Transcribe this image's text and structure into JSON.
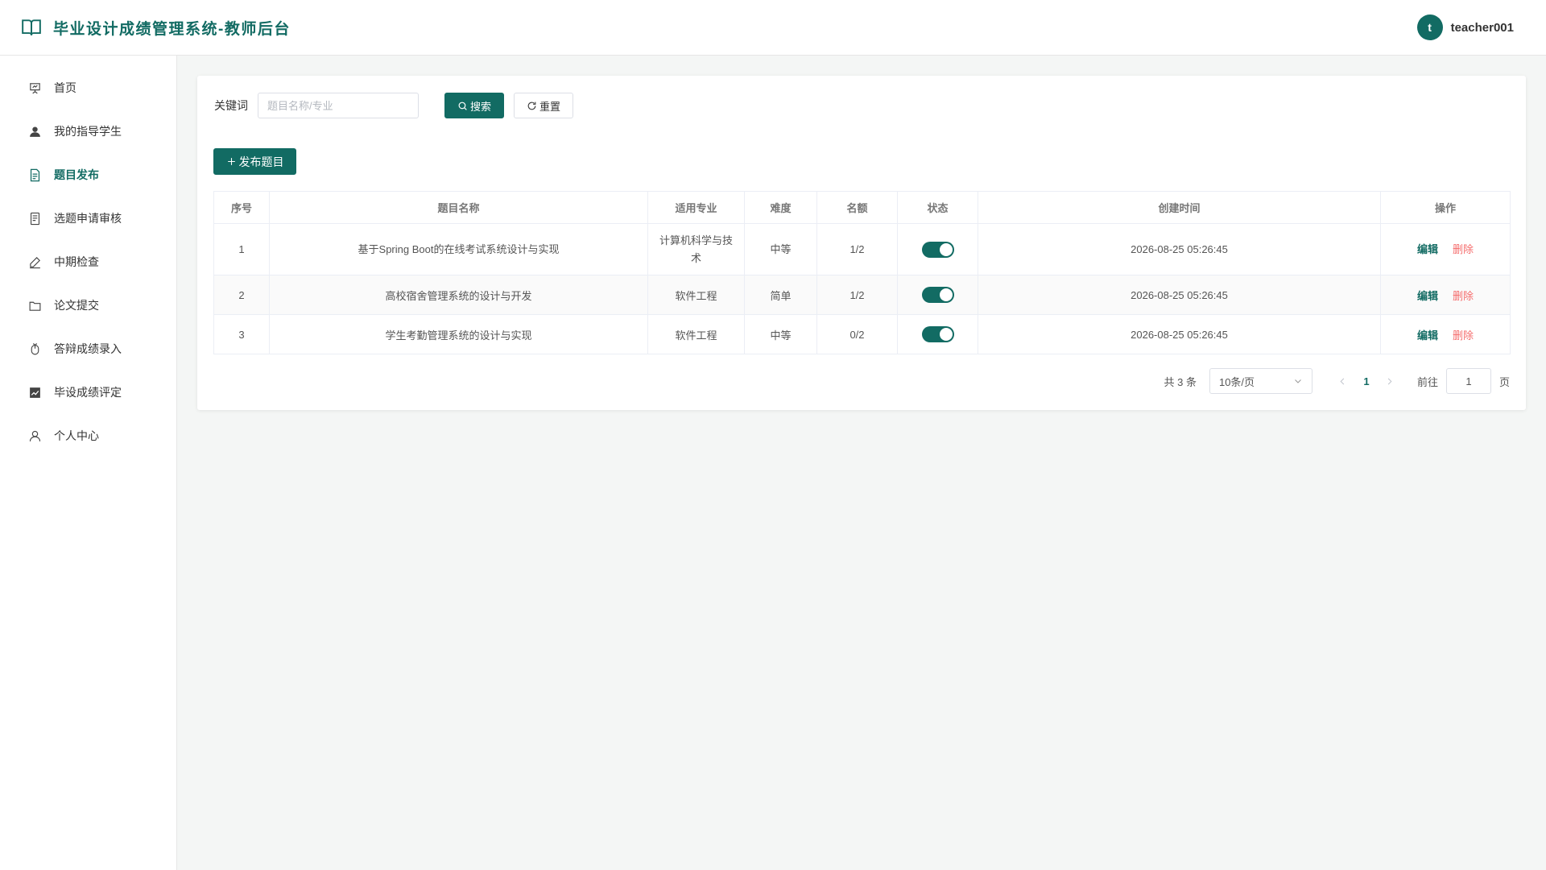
{
  "header": {
    "title": "毕业设计成绩管理系统-教师后台",
    "avatar_letter": "t",
    "username": "teacher001"
  },
  "sidebar": {
    "items": [
      {
        "label": "首页",
        "icon": "presentation-icon"
      },
      {
        "label": "我的指导学生",
        "icon": "user-filled-icon"
      },
      {
        "label": "题目发布",
        "icon": "document-icon",
        "active": true
      },
      {
        "label": "选题申请审核",
        "icon": "document-list-icon"
      },
      {
        "label": "中期检查",
        "icon": "edit-pen-icon"
      },
      {
        "label": "论文提交",
        "icon": "folder-icon"
      },
      {
        "label": "答辩成绩录入",
        "icon": "mouse-icon"
      },
      {
        "label": "毕设成绩评定",
        "icon": "chart-icon"
      },
      {
        "label": "个人中心",
        "icon": "user-icon"
      }
    ]
  },
  "search": {
    "label": "关键词",
    "placeholder": "题目名称/专业",
    "search_label": "搜索",
    "reset_label": "重置"
  },
  "toolbar": {
    "publish_label": "发布题目"
  },
  "table": {
    "headers": [
      "序号",
      "题目名称",
      "适用专业",
      "难度",
      "名额",
      "状态",
      "创建时间",
      "操作"
    ],
    "rows": [
      {
        "no": "1",
        "title": "基于Spring Boot的在线考试系统设计与实现",
        "major": "计算机科学与技术",
        "difficulty": "中等",
        "quota": "1/2",
        "enabled": true,
        "created": "2026-08-25 05:26:45"
      },
      {
        "no": "2",
        "title": "高校宿舍管理系统的设计与开发",
        "major": "软件工程",
        "difficulty": "简单",
        "quota": "1/2",
        "enabled": true,
        "created": "2026-08-25 05:26:45"
      },
      {
        "no": "3",
        "title": "学生考勤管理系统的设计与实现",
        "major": "软件工程",
        "difficulty": "中等",
        "quota": "0/2",
        "enabled": true,
        "created": "2026-08-25 05:26:45"
      }
    ],
    "edit_label": "编辑",
    "delete_label": "删除"
  },
  "pagination": {
    "total_text": "共 3 条",
    "page_size": "10条/页",
    "current_page": "1",
    "goto_label": "前往",
    "goto_value": "1",
    "page_suffix": "页"
  },
  "colors": {
    "primary": "#126b63",
    "danger": "#f56c6c"
  }
}
